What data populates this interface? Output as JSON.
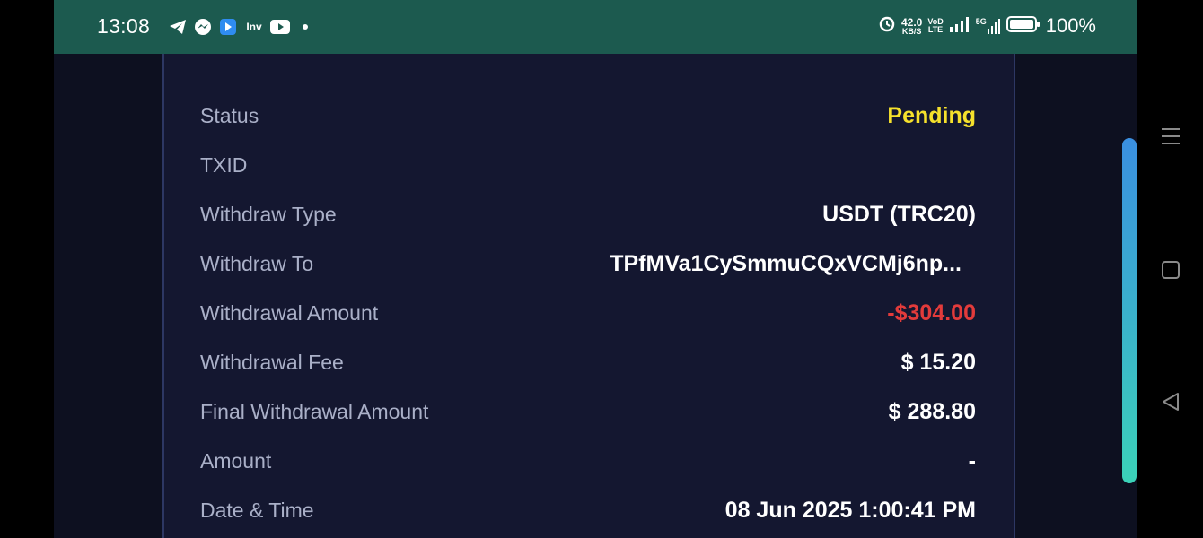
{
  "status_bar": {
    "time": "13:08",
    "left_icons": [
      "telegram-icon",
      "messenger-icon",
      "app-icon",
      "inv-icon",
      "youtube-icon",
      "dot-icon"
    ],
    "inv_label": "Inv",
    "net_speed_value": "42.0",
    "net_speed_unit": "KB/S",
    "volte_top": "VoD",
    "volte_bottom": "LTE",
    "network": "5G",
    "battery": "100%"
  },
  "details": {
    "rows": [
      {
        "label": "Status",
        "value": "Pending"
      },
      {
        "label": "TXID",
        "value": ""
      },
      {
        "label": "Withdraw Type",
        "value": "USDT (TRC20)"
      },
      {
        "label": "Withdraw To",
        "value": "TPfMVa1CySmmuCQxVCMj6np..."
      },
      {
        "label": "Withdrawal Amount",
        "value": "-$304.00"
      },
      {
        "label": "Withdrawal Fee",
        "value": "$ 15.20"
      },
      {
        "label": "Final Withdrawal Amount",
        "value": "$ 288.80"
      },
      {
        "label": "Amount",
        "value": "-"
      },
      {
        "label": "Date & Time",
        "value": "08 Jun 2025 1:00:41 PM"
      }
    ]
  },
  "colors": {
    "status_bar": "#1c5a4f",
    "panel_bg": "#141730",
    "pending": "#f6e12c",
    "negative": "#e33b3b",
    "label": "#aab0c8",
    "scrollbar_top": "#3a8fe0",
    "scrollbar_bottom": "#3bd2b8"
  },
  "nav_buttons": [
    "menu-icon",
    "home-icon",
    "back-icon"
  ]
}
